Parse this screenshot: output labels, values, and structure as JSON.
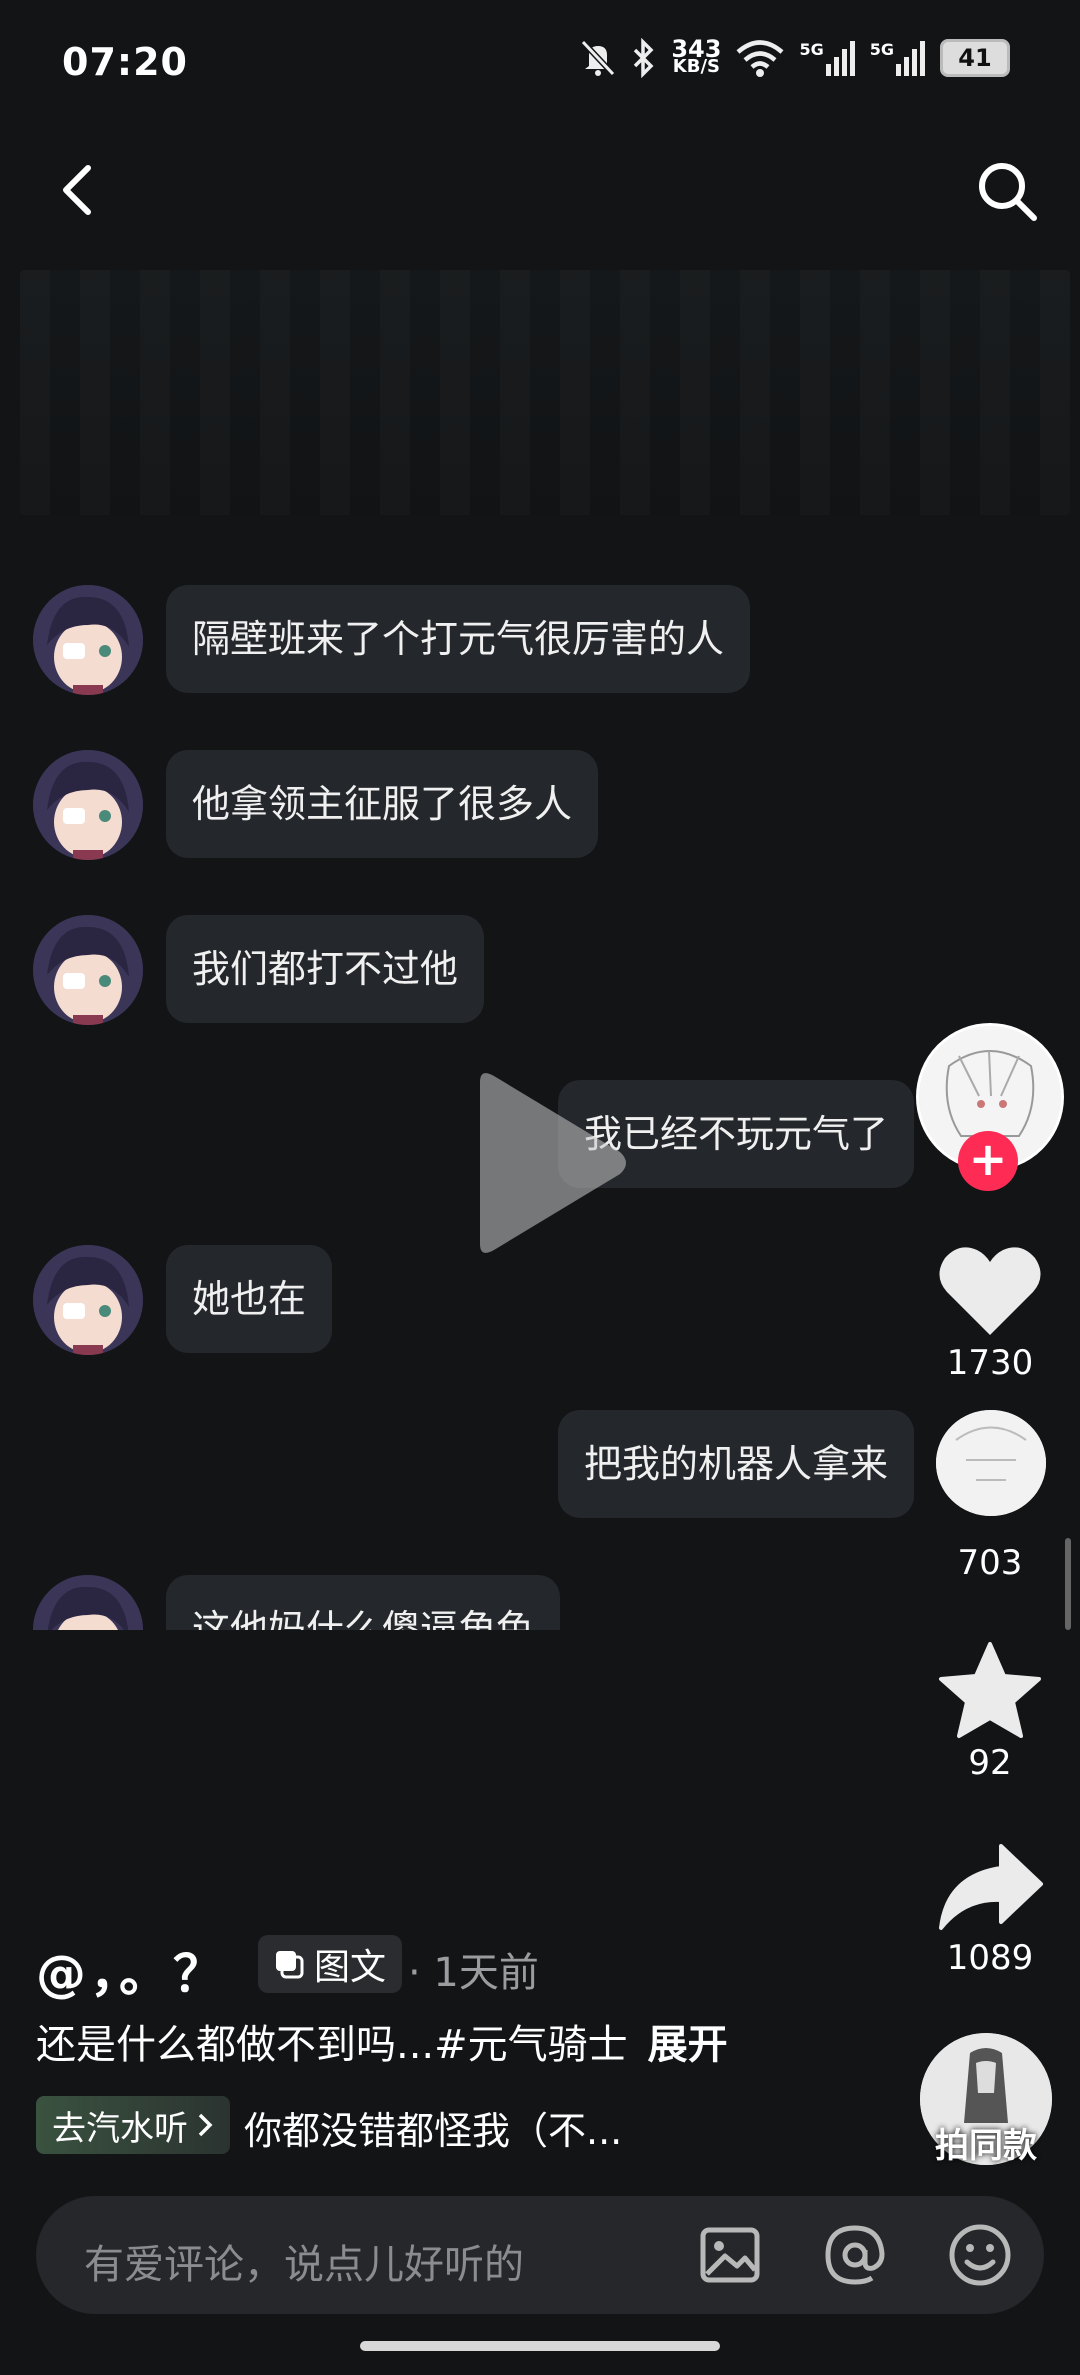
{
  "status_bar": {
    "time": "07:20",
    "net_speed_value": "343",
    "net_speed_unit": "KB/S",
    "signal_1_label": "5G",
    "signal_2_label": "5G",
    "battery": "41"
  },
  "header": {
    "back_icon": "chevron-left-icon",
    "search_icon": "search-icon"
  },
  "chat": {
    "messages": [
      {
        "side": "left",
        "text": "隔壁班来了个打元气很厉害的人"
      },
      {
        "side": "left",
        "text": "他拿领主征服了很多人"
      },
      {
        "side": "left",
        "text": "我们都打不过他"
      },
      {
        "side": "right",
        "text": "我已经不玩元气了"
      },
      {
        "side": "left",
        "text": "她也在"
      },
      {
        "side": "right",
        "text": "把我的机器人拿来"
      },
      {
        "side": "left",
        "text": "这他妈什么傻逼角色"
      }
    ]
  },
  "rail": {
    "follow_label": "+",
    "like_count": "1730",
    "comment_count": "703",
    "favorite_count": "92",
    "share_count": "1089",
    "shoot_same_label": "拍同款"
  },
  "post": {
    "author": "@，。？",
    "type_label": "图文",
    "time_ago": "· 1天前",
    "description": "还是什么都做不到吗...#元气骑士",
    "expand_label": "展开",
    "music_button": "去汽水听",
    "music_title": "你都没错都怪我（不..."
  },
  "comment_bar": {
    "placeholder": "有爱评论，说点儿好听的"
  },
  "colors": {
    "background": "#121416",
    "bubble": "#24272b",
    "accent": "#fe2c55"
  }
}
